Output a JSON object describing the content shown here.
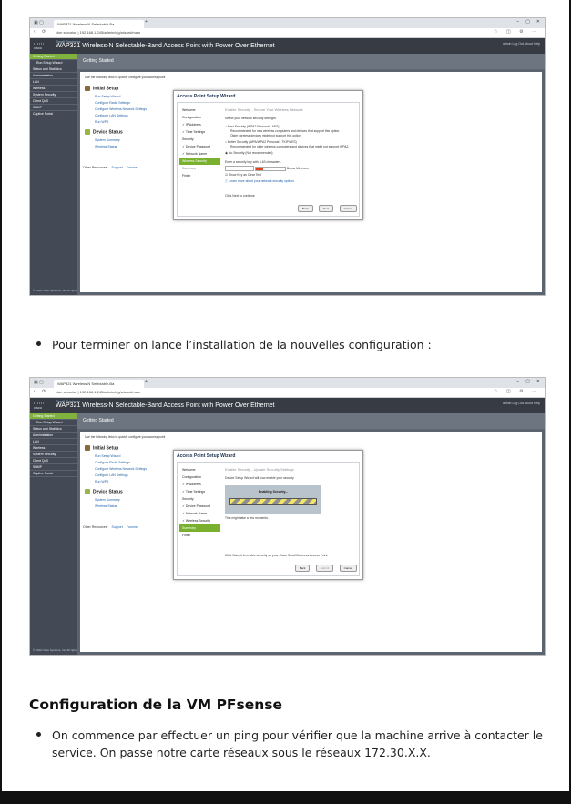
{
  "doc": {
    "bullet1": "Pour terminer on lance l’installation de la nouvelles configuration :",
    "heading": "Configuration de la VM PFsense",
    "bullet2_line1": "On commence par effectuer un ping pour vérifier que la machine arrive à contacter le",
    "bullet2_line2": "service. On passe notre carte réseaux sous le réseaux 172.30.X.X."
  },
  "screen1": {
    "tab_title": "WAP321 Wireless-N Selectable-Ba",
    "url": "Non sécurisé | 192.168.1.245/admin/cfg/wizard/main",
    "brand_line": "Small Business",
    "logo": "cisco",
    "app_title": "WAP321 Wireless-N Selectable-Band Access Point with Power Over Ethernet",
    "top_links": "admin   Log Out   About   Help",
    "crumb": "Getting Started",
    "intro": "Use the following links to quickly configure your access point",
    "initial_setup": "Initial Setup",
    "setup_links": [
      "Run Setup Wizard",
      "Configure Radio Settings",
      "Configure Wireless Network Settings",
      "Configure LAN Settings",
      "Run WPS"
    ],
    "device_status": "Device Status",
    "status_links": [
      "System Summary",
      "Wireless Status"
    ],
    "other_resources": "Other Resources:",
    "other_links": [
      "Support",
      "Forums"
    ],
    "nav_items": [
      "Getting Started",
      "Run Setup Wizard",
      "Status and Statistics",
      "Administration",
      "LAN",
      "Wireless",
      "System Security",
      "Client QoS",
      "SNMP",
      "Captive Portal"
    ],
    "footer": "© 2012 Cisco Systems, Inc. All rights reserved.",
    "modal_title": "Access Point Setup Wizard",
    "steps": [
      "Welcome",
      "Configuration",
      "✓ IP Address",
      "✓ Time Settings",
      "Security",
      "✓ Device Password",
      "✓ Network Name",
      "Wireless Security",
      "Summary",
      "Finish"
    ],
    "active_step": "Wireless Security",
    "wiz_header": "Enable Security - Secure Your Wireless Network",
    "select_text": "Select your network security strength.",
    "opt1": "Best Security (WPA2 Personal - AES)",
    "opt1_sub": "Recommended for new wireless computers and devices that support this option.",
    "opt1_sub2": "Older wireless devices might not support this option.",
    "opt2": "Better Security (WPA/WPA2 Personal - TKIP/AES)",
    "opt2_sub": "Recommended for older wireless computers and devices that might not support WPA2.",
    "opt3": "No Security (Not recommended)",
    "key_label": "Enter a security key with 8-63 characters.",
    "strength": "Below Minimum",
    "show_key": "Show Key as Clear Text",
    "learn_more": "Learn more about your network security options",
    "click_next": "Click Next to continue",
    "buttons": [
      "Back",
      "Next",
      "Cancel"
    ]
  },
  "screen2": {
    "tab_title": "WAP321 Wireless-N Selectable-Ba",
    "url": "Non sécurisé | 192.168.1.245/admin/cfg/wizard/main",
    "brand_line": "Small Business",
    "logo": "cisco",
    "app_title": "WAP321 Wireless-N Selectable-Band Access Point with Power Over Ethernet",
    "top_links": "admin   Log Out   About   Help",
    "crumb": "Getting Started",
    "intro": "Use the following links to quickly configure your access point",
    "initial_setup": "Initial Setup",
    "setup_links": [
      "Run Setup Wizard",
      "Configure Radio Settings",
      "Configure Wireless Network Settings",
      "Configure LAN Settings",
      "Run WPS"
    ],
    "device_status": "Device Status",
    "status_links": [
      "System Summary",
      "Wireless Status"
    ],
    "other_resources": "Other Resources:",
    "other_links": [
      "Support",
      "Forums"
    ],
    "nav_items": [
      "Getting Started",
      "Run Setup Wizard",
      "Status and Statistics",
      "Administration",
      "LAN",
      "Wireless",
      "System Security",
      "Client QoS",
      "SNMP",
      "Captive Portal"
    ],
    "footer": "© 2012 Cisco Systems, Inc. All rights reserved.",
    "modal_title": "Access Point Setup Wizard",
    "steps": [
      "Welcome",
      "Configuration",
      "✓ IP Address",
      "✓ Time Settings",
      "Security",
      "✓ Device Password",
      "✓ Network Name",
      "✓ Wireless Security",
      "Summary",
      "Finish"
    ],
    "active_step": "Summary",
    "wiz_header": "Enable Security - Update Security Settings",
    "wiz_sub": "Device Setup Wizard will now enable your security.",
    "progress_label": "Enabling Security...",
    "progress_note": "This might take a few moments.",
    "click_submit": "Click Submit to enable security on your Cisco Small Business Access Point",
    "buttons": [
      "Back",
      "Submit",
      "Cancel"
    ]
  },
  "colors": {
    "accent": "#79b12f",
    "nav_bg": "#434a55",
    "header_bg": "#363b44"
  }
}
